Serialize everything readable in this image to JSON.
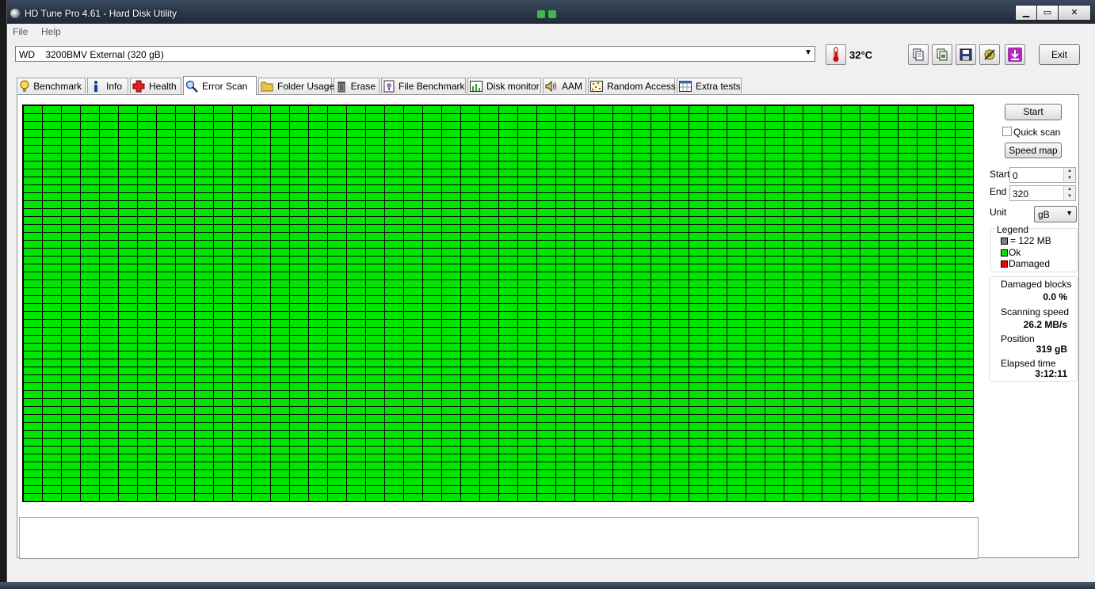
{
  "window": {
    "title": "HD Tune Pro 4.61 - Hard Disk Utility",
    "controls": {
      "minimize": "▁",
      "maximize": "▭",
      "close": "✕"
    }
  },
  "menu": {
    "file": "File",
    "help": "Help"
  },
  "toolbar": {
    "drive": "WD    3200BMV External (320 gB)",
    "temperature": "32°C",
    "exit_label": "Exit"
  },
  "tabs": [
    {
      "label": "Benchmark",
      "icon": "bulb-icon"
    },
    {
      "label": "Info",
      "icon": "info-icon"
    },
    {
      "label": "Health",
      "icon": "health-cross-icon"
    },
    {
      "label": "Error Scan",
      "icon": "magnifier-icon"
    },
    {
      "label": "Folder Usage",
      "icon": "folder-icon"
    },
    {
      "label": "Erase",
      "icon": "trash-icon"
    },
    {
      "label": "File Benchmark",
      "icon": "file-bulb-icon"
    },
    {
      "label": "Disk monitor",
      "icon": "chart-icon"
    },
    {
      "label": "AAM",
      "icon": "speaker-icon"
    },
    {
      "label": "Random Access",
      "icon": "random-grid-icon"
    },
    {
      "label": "Extra tests",
      "icon": "calendar-grid-icon"
    }
  ],
  "active_tab": "Error Scan",
  "scan_grid": {
    "block_state": "Ok",
    "ok_color": "#00e600",
    "damaged_color": "#ff0000",
    "block_color": "#808080"
  },
  "controls": {
    "start_button": "Start",
    "quick_scan_label": "Quick scan",
    "quick_scan_checked": false,
    "speed_map_button": "Speed map",
    "start_label": "Start",
    "start_value": "0",
    "end_label": "End",
    "end_value": "320",
    "unit_label": "Unit",
    "unit_value": "gB"
  },
  "legend": {
    "title": "Legend",
    "block": "= 122 MB",
    "ok": "Ok",
    "damaged": "Damaged"
  },
  "stats": {
    "damaged_blocks_label": "Damaged blocks",
    "damaged_blocks_value": "0.0 %",
    "scanning_speed_label": "Scanning speed",
    "scanning_speed_value": "26.2 MB/s",
    "position_label": "Position",
    "position_value": "319 gB",
    "elapsed_label": "Elapsed time",
    "elapsed_value": "3:12:11"
  }
}
